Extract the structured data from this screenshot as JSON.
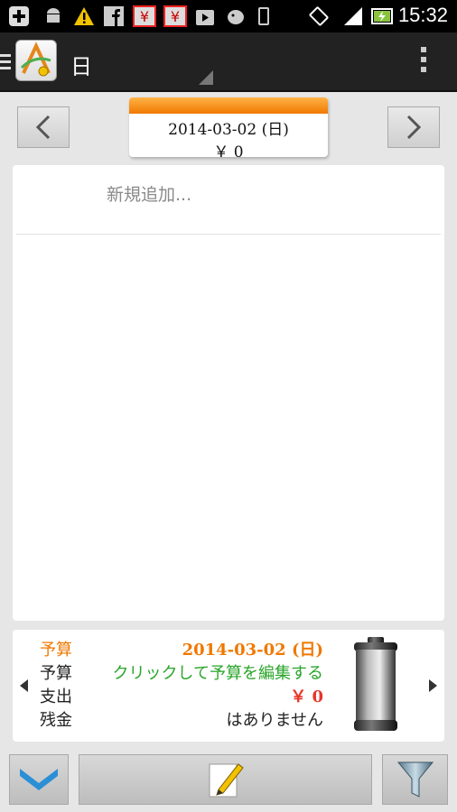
{
  "status_bar": {
    "time": "15:32",
    "icons": [
      "plus-circle-icon",
      "android-icon",
      "warning-icon",
      "facebook-icon",
      "yahoo-icon",
      "yahoo-icon",
      "play-store-icon",
      "bird-icon",
      "phone-icon",
      "rotate-icon",
      "signal-icon",
      "battery-charging-icon"
    ]
  },
  "action_bar": {
    "title": "日",
    "icons": {
      "menu": "hamburger-icon",
      "logo": "app-logo-icon",
      "overflow": "overflow-menu-icon"
    }
  },
  "date_nav": {
    "date": "2014-03-02 (日)",
    "amount": "￥ 0",
    "prev_icon": "chevron-left-icon",
    "next_icon": "chevron-right-icon"
  },
  "list": {
    "add_new": "新規追加..."
  },
  "summary": {
    "rows": [
      {
        "label": "予算",
        "value": "2014-03-02 (日)"
      },
      {
        "label": "予算",
        "value": "クリックして予算を編集する"
      },
      {
        "label": "支出",
        "value": "￥ 0"
      },
      {
        "label": "残金",
        "value": "はありません"
      }
    ],
    "colors": {
      "orange": "#f07800",
      "green": "#2aa52a",
      "red": "#e8352a",
      "text": "#222222"
    },
    "icon": "battery-icon"
  },
  "bottom_bar": {
    "icons": [
      "chevron-down-icon",
      "pencil-icon",
      "filter-icon"
    ]
  }
}
